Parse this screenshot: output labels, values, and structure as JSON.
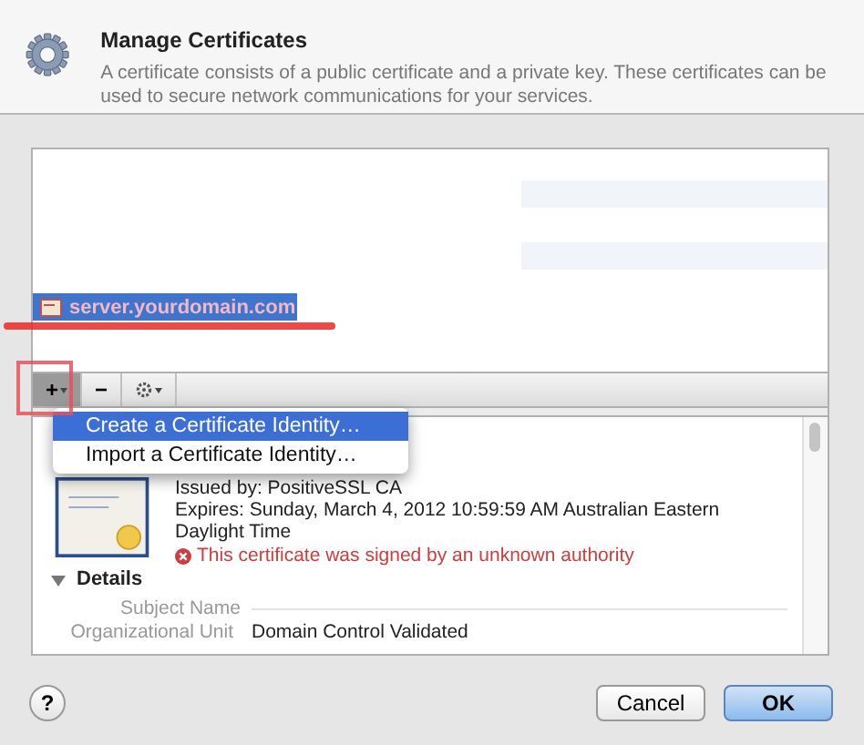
{
  "header": {
    "title": "Manage Certificates",
    "description": "A certificate consists of a public certificate and a private key. These certificates can be used to secure network communications for your services."
  },
  "certificates": [
    {
      "name": "server.yourdomain.com",
      "selected": true
    }
  ],
  "toolbar": [
    {
      "kind": "add",
      "label": "+",
      "selected": true
    },
    {
      "kind": "remove",
      "label": "−",
      "selected": false
    },
    {
      "kind": "actions",
      "selected": false
    }
  ],
  "menu": {
    "items": [
      {
        "label": "Create a Certificate Identity…",
        "selected": true
      },
      {
        "label": "Import a Certificate Identity…",
        "selected": false
      }
    ]
  },
  "details": {
    "issued_by": "Issued by: PositiveSSL CA",
    "expires": "Expires: Sunday, March 4, 2012 10:59:59 AM Australian Eastern Daylight Time",
    "error": "This certificate was signed by an unknown authority",
    "section": {
      "label": "Details",
      "expanded": true
    },
    "fields": [
      {
        "kind": "heading",
        "label": "Subject Name"
      },
      {
        "kind": "row",
        "label": "Organizational Unit",
        "value": "Domain Control Validated"
      }
    ]
  },
  "footer": {
    "help": "?",
    "buttons": [
      {
        "kind": "cancel",
        "label": "Cancel"
      },
      {
        "kind": "default",
        "label": "OK"
      }
    ]
  }
}
